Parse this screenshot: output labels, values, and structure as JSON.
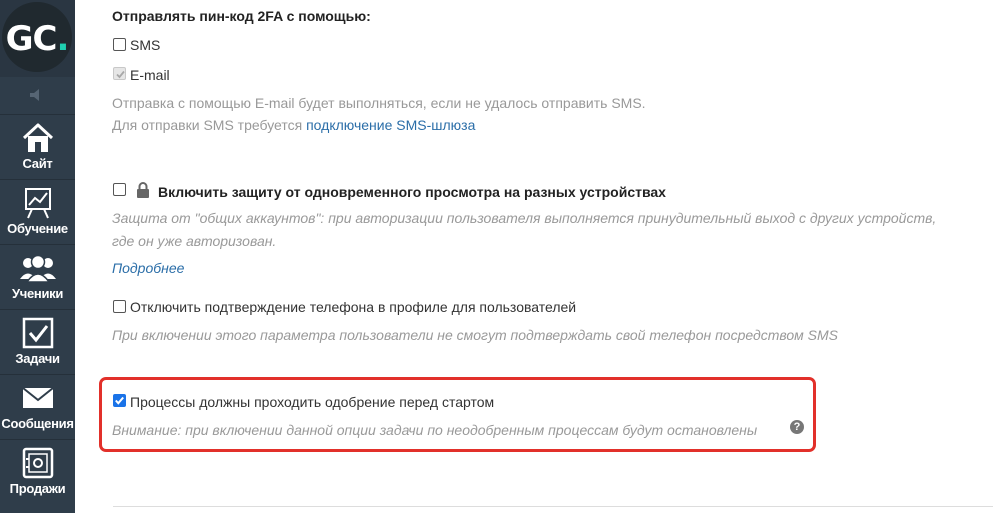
{
  "sidebar": {
    "logo": {
      "text": "GC",
      "dot": "."
    },
    "items": [
      {
        "label": "Сайт",
        "icon": "home-icon"
      },
      {
        "label": "Обучение",
        "icon": "chart-board-icon"
      },
      {
        "label": "Ученики",
        "icon": "users-icon"
      },
      {
        "label": "Задачи",
        "icon": "checkbox-task-icon"
      },
      {
        "label": "Сообщения",
        "icon": "envelope-icon"
      },
      {
        "label": "Продажи",
        "icon": "safe-icon"
      }
    ]
  },
  "settings": {
    "twofa": {
      "heading": "Отправлять пин-код 2FA с помощью:",
      "sms_label": "SMS",
      "email_label": "E-mail",
      "note1": "Отправка с помощью E-mail будет выполняться, если не удалось отправить SMS.",
      "note2_prefix": "Для отправки SMS требуется",
      "note2_link": "подключение SMS-шлюза"
    },
    "concurrent": {
      "label": "Включить защиту от одновременного просмотра на разных устройствах",
      "desc1": "Защита от \"общих аккаунтов\": при авторизации пользователя выполняется принудительный выход с других устройств,",
      "desc2": "где он уже авторизован.",
      "more_link": "Подробнее"
    },
    "phone": {
      "label": "Отключить подтверждение телефона в профиле для пользователей",
      "desc": "При включении этого параметра пользователи не смогут подтверждать свой телефон посредством SMS"
    },
    "approval": {
      "label": "Процессы должны проходить одобрение перед стартом",
      "warning": "Внимание: при включении данной опции задачи по неодобренным процессам будут остановлены",
      "help": "?"
    }
  },
  "colors": {
    "sidebar": "#2f3d4a",
    "accent": "#1fcfb0",
    "link": "#2b6ea8",
    "highlight": "#e2302a",
    "checkbox": "#1a73e8"
  }
}
